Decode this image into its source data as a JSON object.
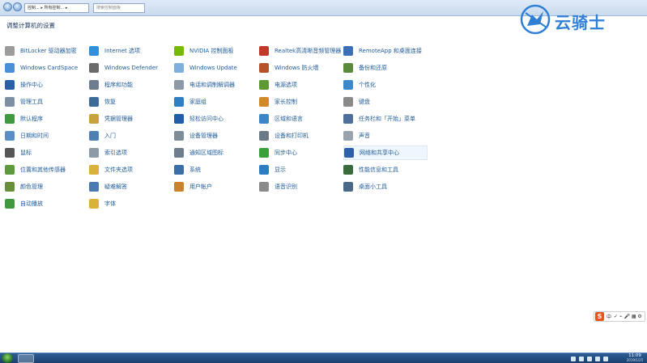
{
  "window": {
    "address": "控制... ▸ 所有控制... ▸",
    "search_placeholder": "搜索控制面板"
  },
  "logo": {
    "text": "云骑士"
  },
  "heading": "调整计算机的设置",
  "items": [
    {
      "label": "BitLocker 驱动器加密",
      "icon": "lock-icon",
      "color": "#9c9c9c"
    },
    {
      "label": "Internet 选项",
      "icon": "globe-icon",
      "color": "#2f8fd8"
    },
    {
      "label": "NVIDIA 控制面板",
      "icon": "nvidia-icon",
      "color": "#76b900"
    },
    {
      "label": "Realtek高清晰音频管理器",
      "icon": "speaker-icon",
      "color": "#c0392b"
    },
    {
      "label": "RemoteApp 和桌面连接",
      "icon": "remote-desktop-icon",
      "color": "#3b6fb6"
    },
    {
      "label": "Windows CardSpace",
      "icon": "cardspace-icon",
      "color": "#4a90d9"
    },
    {
      "label": "Windows Defender",
      "icon": "defender-icon",
      "color": "#6b6b6b"
    },
    {
      "label": "Windows Update",
      "icon": "update-icon",
      "color": "#7fb0dd"
    },
    {
      "label": "Windows 防火墙",
      "icon": "firewall-icon",
      "color": "#b4532a"
    },
    {
      "label": "备份和还原",
      "icon": "backup-icon",
      "color": "#5a8a3a"
    },
    {
      "label": "操作中心",
      "icon": "flag-icon",
      "color": "#2b5ea8"
    },
    {
      "label": "程序和功能",
      "icon": "programs-icon",
      "color": "#6f7e8f"
    },
    {
      "label": "电话和调制解调器",
      "icon": "phone-icon",
      "color": "#8d99a6"
    },
    {
      "label": "电源选项",
      "icon": "power-icon",
      "color": "#5e9a33"
    },
    {
      "label": "个性化",
      "icon": "personalize-icon",
      "color": "#3c89c9"
    },
    {
      "label": "管理工具",
      "icon": "admin-tools-icon",
      "color": "#7d8fa5"
    },
    {
      "label": "恢复",
      "icon": "recovery-icon",
      "color": "#3d6b99"
    },
    {
      "label": "家庭组",
      "icon": "homegroup-icon",
      "color": "#2f7fc4"
    },
    {
      "label": "家长控制",
      "icon": "parental-icon",
      "color": "#d08a2a"
    },
    {
      "label": "键盘",
      "icon": "keyboard-icon",
      "color": "#8a8a8a"
    },
    {
      "label": "默认程序",
      "icon": "default-programs-icon",
      "color": "#3f9a3f"
    },
    {
      "label": "凭据管理器",
      "icon": "credential-icon",
      "color": "#c7a23d"
    },
    {
      "label": "轻松访问中心",
      "icon": "ease-access-icon",
      "color": "#1f5fa8"
    },
    {
      "label": "区域和语言",
      "icon": "region-icon",
      "color": "#3a86c6"
    },
    {
      "label": "任务栏和「开始」菜单",
      "icon": "taskbar-icon",
      "color": "#4d6f9a"
    },
    {
      "label": "日期和时间",
      "icon": "clock-icon",
      "color": "#5b8ec4"
    },
    {
      "label": "入门",
      "icon": "getting-started-icon",
      "color": "#4f7fb5"
    },
    {
      "label": "设备管理器",
      "icon": "device-manager-icon",
      "color": "#7f8c99"
    },
    {
      "label": "设备和打印机",
      "icon": "printer-icon",
      "color": "#6c7a88"
    },
    {
      "label": "声音",
      "icon": "sound-icon",
      "color": "#9aa3ad"
    },
    {
      "label": "鼠标",
      "icon": "mouse-icon",
      "color": "#555555"
    },
    {
      "label": "索引选项",
      "icon": "index-icon",
      "color": "#8d9aa8"
    },
    {
      "label": "通知区域图标",
      "icon": "notification-icon",
      "color": "#6f7e8f"
    },
    {
      "label": "同步中心",
      "icon": "sync-icon",
      "color": "#3aa13a"
    },
    {
      "label": "网络和共享中心",
      "icon": "network-icon",
      "color": "#2f5fa8"
    },
    {
      "label": "位置和其他传感器",
      "icon": "sensor-icon",
      "color": "#5c9a3a"
    },
    {
      "label": "文件夹选项",
      "icon": "folder-icon",
      "color": "#d9b13b"
    },
    {
      "label": "系统",
      "icon": "system-icon",
      "color": "#3d6ea8"
    },
    {
      "label": "显示",
      "icon": "display-icon",
      "color": "#2e7dc2"
    },
    {
      "label": "性能信息和工具",
      "icon": "performance-icon",
      "color": "#3b6b3b"
    },
    {
      "label": "颜色管理",
      "icon": "color-icon",
      "color": "#6a8f3a"
    },
    {
      "label": "疑难解答",
      "icon": "troubleshoot-icon",
      "color": "#4a7ab0"
    },
    {
      "label": "用户帐户",
      "icon": "user-accounts-icon",
      "color": "#c9832c"
    },
    {
      "label": "语音识别",
      "icon": "microphone-icon",
      "color": "#8a8a8a"
    },
    {
      "label": "桌面小工具",
      "icon": "gadgets-icon",
      "color": "#4b6a8a"
    },
    {
      "label": "自动播放",
      "icon": "autoplay-icon",
      "color": "#3f9a3f"
    },
    {
      "label": "字体",
      "icon": "font-icon",
      "color": "#d9b13b"
    }
  ],
  "ime": {
    "label": "中",
    "extra": "✓ ⌁ 🎤 ▦ ⚙"
  },
  "clock": {
    "time": "11:09",
    "date": "2019/1/25"
  }
}
